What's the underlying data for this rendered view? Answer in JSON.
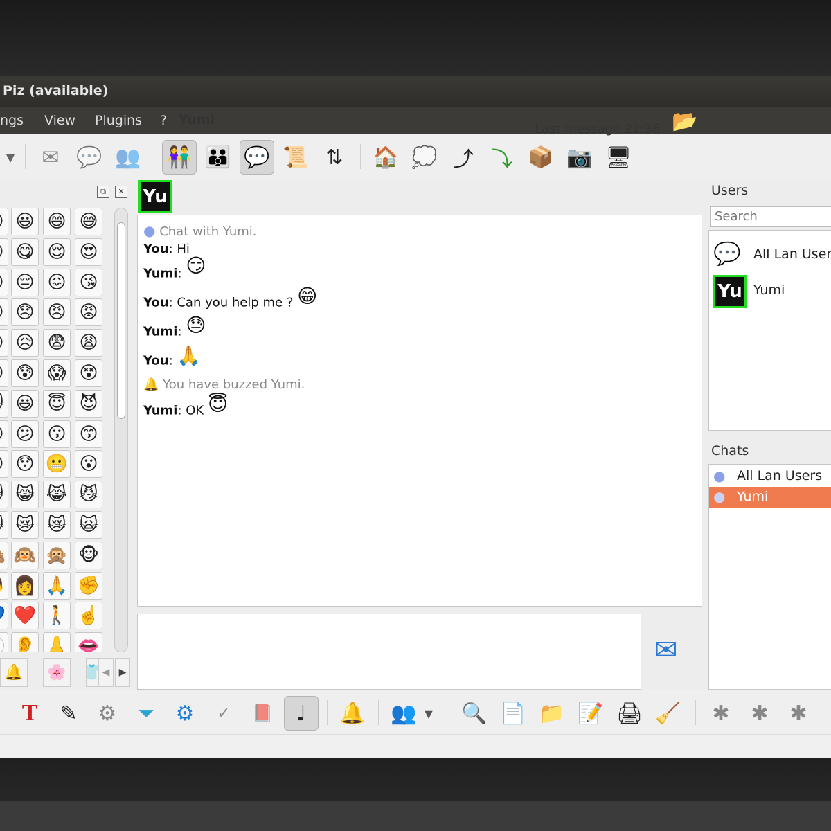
{
  "window": {
    "title": "Piz (available)"
  },
  "menu": [
    "ngs",
    "View",
    "Plugins",
    "?"
  ],
  "toolbar_icons": [
    "dropdown-arrow-icon",
    "mail-icon",
    "chat-bubbles-icon",
    "users-add-icon",
    "contacts-icon",
    "group-icon",
    "chat-icon",
    "script-icon",
    "transfer-icon",
    "home-icon",
    "speech-icon",
    "upload-icon",
    "download-icon",
    "dropbox-icon",
    "webcam-icon",
    "monitor-icon"
  ],
  "emoji": {
    "rows": [
      [
        "😀",
        "😃",
        "😄",
        "😅"
      ],
      [
        "😊",
        "😋",
        "😌",
        "😍"
      ],
      [
        "😉",
        "😔",
        "😖",
        "😘"
      ],
      [
        "😟",
        "😞",
        "😠",
        "😡"
      ],
      [
        "😣",
        "😥",
        "😨",
        "😩"
      ],
      [
        "😰",
        "😰",
        "😱",
        "😵"
      ],
      [
        "😸",
        "😃",
        "😇",
        "😈"
      ],
      [
        "😐",
        "😕",
        "😗",
        "😙"
      ],
      [
        "😶",
        "😯",
        "😬",
        "😮"
      ],
      [
        "😺",
        "😸",
        "😹",
        "😼"
      ],
      [
        "😼",
        "😿",
        "😿",
        "🙀"
      ],
      [
        "🙈",
        "🙉",
        "🙊",
        "🐵"
      ],
      [
        "👨",
        "👩",
        "🙏",
        "✊"
      ],
      [
        "💙",
        "❤️",
        "🚶",
        "☝️"
      ],
      [
        "👀",
        "👂",
        "👃",
        "👄"
      ]
    ],
    "tabs": [
      "🔔",
      "🌸",
      "👕"
    ]
  },
  "chat": {
    "avatar_text": "Yu",
    "contact_name": "Yumi",
    "last_message": "Last message 22:36",
    "intro": "Chat with Yumi.",
    "messages": [
      {
        "sender": "You",
        "text": ": Hi",
        "emoji": ""
      },
      {
        "sender": "Yumi",
        "text": ":",
        "emoji": "😏"
      },
      {
        "sender": "You",
        "text": ": Can you help me ?",
        "emoji": "😁"
      },
      {
        "sender": "Yumi",
        "text": ":",
        "emoji": "😓"
      },
      {
        "sender": "You",
        "text": ":",
        "emoji": "🙏"
      },
      {
        "sender": "Yumi",
        "text": ": OK",
        "emoji": "😇"
      }
    ],
    "buzz": "You have buzzed Yumi."
  },
  "users": {
    "title": "Users",
    "search_placeholder": "Search",
    "items": [
      {
        "label": "All Lan Users",
        "icon": "group-chat-icon"
      },
      {
        "label": "Yumi",
        "avatar_text": "Yu"
      }
    ]
  },
  "chats": {
    "title": "Chats",
    "items": [
      {
        "label": "All Lan Users",
        "selected": false
      },
      {
        "label": "Yumi",
        "selected": true
      }
    ]
  },
  "colors": {
    "selection": "#ef7b4e",
    "avatar_border": "#22dd22"
  }
}
